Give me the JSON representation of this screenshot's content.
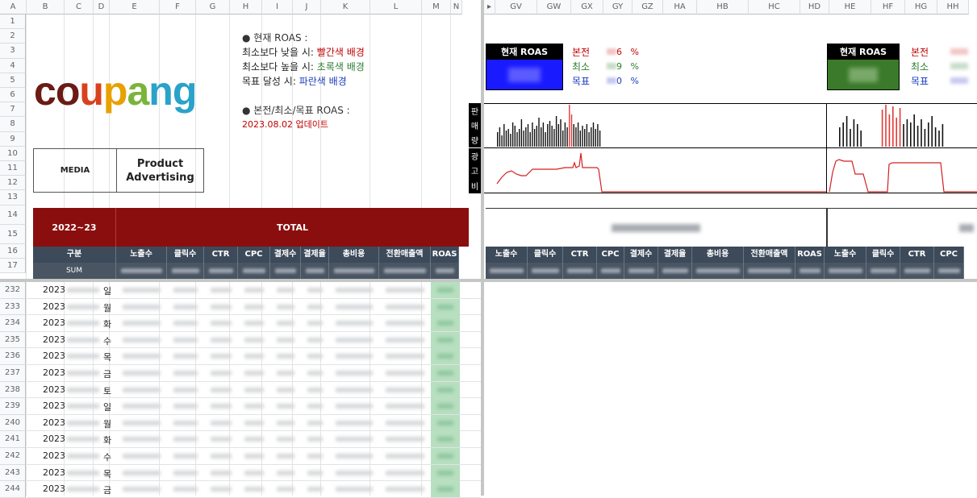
{
  "columns_left": [
    "A",
    "B",
    "C",
    "D",
    "E",
    "F",
    "G",
    "H",
    "I",
    "J",
    "K",
    "L",
    "M",
    "N"
  ],
  "columns_right": [
    "GV",
    "GW",
    "GX",
    "GY",
    "GZ",
    "HA",
    "HB",
    "HC",
    "HD",
    "HE",
    "HF",
    "HG",
    "HH"
  ],
  "rows_top": [
    "1",
    "2",
    "3",
    "4",
    "5",
    "6",
    "7",
    "8",
    "9",
    "10",
    "11",
    "12",
    "13",
    "14",
    "15",
    "16",
    "17"
  ],
  "rows_data": [
    "232",
    "233",
    "234",
    "235",
    "236",
    "237",
    "238",
    "239",
    "240",
    "241",
    "242",
    "243",
    "244"
  ],
  "brand_logo": "coupang",
  "notes": {
    "roas_header": "● 현재 ROAS :",
    "line1_prefix": "최소보다 낮을 시: ",
    "line1_value": "빨간색 배경",
    "line2_prefix": "최소보다 높을 시: ",
    "line2_value": "초록색 배경",
    "line3_prefix": "목표 달성 시: ",
    "line3_value": "파란색 배경",
    "roas_header2": "● 본전/최소/목표 ROAS :",
    "update_date": "2023.08.02",
    "update_label": "업데이트"
  },
  "media_label": "MEDIA",
  "product_label": "Product\nAdvertising",
  "period_label": "2022~23",
  "total_label": "TOTAL",
  "table_headers": [
    "구분",
    "노출수",
    "클릭수",
    "CTR",
    "CPC",
    "결제수",
    "결제율",
    "총비용",
    "전환매출액",
    "ROAS"
  ],
  "sum_label": "SUM",
  "data_rows": [
    {
      "year": "2023",
      "day": "일"
    },
    {
      "year": "2023",
      "day": "월"
    },
    {
      "year": "2023",
      "day": "화"
    },
    {
      "year": "2023",
      "day": "수"
    },
    {
      "year": "2023",
      "day": "목"
    },
    {
      "year": "2023",
      "day": "금"
    },
    {
      "year": "2023",
      "day": "토"
    },
    {
      "year": "2023",
      "day": "일"
    },
    {
      "year": "2023",
      "day": "월"
    },
    {
      "year": "2023",
      "day": "화"
    },
    {
      "year": "2023",
      "day": "수"
    },
    {
      "year": "2023",
      "day": "목"
    },
    {
      "year": "2023",
      "day": "금"
    }
  ],
  "roas_panel_1": {
    "title": "현재 ROAS",
    "color": "#1a1aff",
    "labels": [
      "본전",
      "최소",
      "목표"
    ],
    "values": [
      "6",
      "9",
      "0"
    ],
    "unit": "%"
  },
  "roas_panel_2": {
    "title": "현재 ROAS",
    "color": "#3a7a2a",
    "labels": [
      "본전",
      "최소",
      "목표"
    ]
  },
  "chart_side_labels": {
    "sales": [
      "판",
      "매",
      "량"
    ],
    "ad": [
      "광",
      "고",
      "비"
    ]
  },
  "right_headers": [
    "노출수",
    "클릭수",
    "CTR",
    "CPC",
    "결제수",
    "결제율",
    "총비용",
    "전환매출액",
    "ROAS",
    "노출수",
    "클릭수",
    "CTR",
    "CPC"
  ],
  "colors": {
    "header_red": "#8b0e0e",
    "header_dark": "#3c4a5a",
    "roas_green": "#b7dfc0",
    "red_text": "#c00000",
    "green_text": "#2e7d32",
    "blue_text": "#1a3bbf"
  }
}
